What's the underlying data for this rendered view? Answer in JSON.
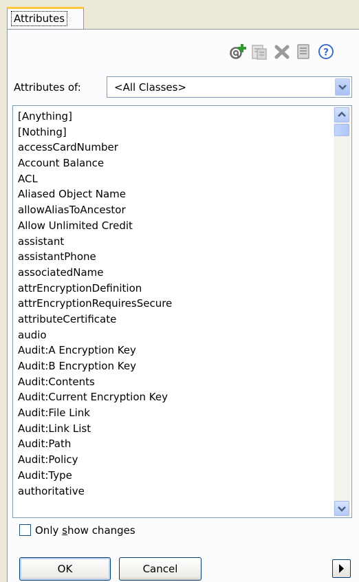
{
  "tab": {
    "label": "Attributes"
  },
  "toolbar": {
    "icons": [
      "add-attribute-icon",
      "rename-attribute-icon",
      "delete-attribute-icon",
      "properties-icon",
      "help-icon"
    ]
  },
  "filter": {
    "label": "Attributes of:",
    "selected": "<All Classes>"
  },
  "attributes": [
    "[Anything]",
    "[Nothing]",
    "accessCardNumber",
    "Account Balance",
    "ACL",
    "Aliased Object Name",
    "allowAliasToAncestor",
    "Allow Unlimited Credit",
    "assistant",
    "assistantPhone",
    "associatedName",
    "attrEncryptionDefinition",
    "attrEncryptionRequiresSecure",
    "attributeCertificate",
    "audio",
    "Audit:A Encryption Key",
    "Audit:B Encryption Key",
    "Audit:Contents",
    "Audit:Current Encryption Key",
    "Audit:File Link",
    "Audit:Link List",
    "Audit:Path",
    "Audit:Policy",
    "Audit:Type",
    "authoritative"
  ],
  "options": {
    "only_show_changes_pre": "Only ",
    "only_show_changes_key": "s",
    "only_show_changes_post": "how changes",
    "only_show_changes_checked": false
  },
  "buttons": {
    "ok": "OK",
    "cancel": "Cancel"
  }
}
